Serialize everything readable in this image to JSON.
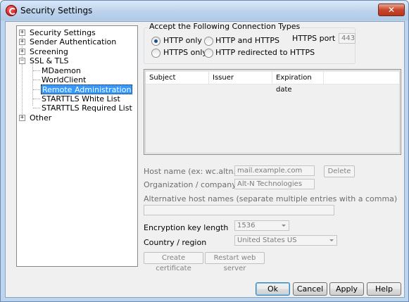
{
  "window": {
    "title": "Security Settings",
    "close_label": "✕"
  },
  "tree": {
    "items": [
      {
        "label": "Security Settings",
        "expander": "+"
      },
      {
        "label": "Sender Authentication",
        "expander": "+"
      },
      {
        "label": "Screening",
        "expander": "+"
      },
      {
        "label": "SSL & TLS",
        "expander": "−"
      },
      {
        "label": "MDaemon"
      },
      {
        "label": "WorldClient"
      },
      {
        "label": "Remote Administration",
        "selected": true
      },
      {
        "label": "STARTTLS White List"
      },
      {
        "label": "STARTTLS Required List"
      },
      {
        "label": "Other",
        "expander": "+"
      }
    ]
  },
  "connection": {
    "group_title": "Accept the Following Connection Types",
    "options": [
      {
        "label": "HTTP only",
        "checked": true
      },
      {
        "label": "HTTP and HTTPS",
        "checked": false
      },
      {
        "label": "HTTPS only",
        "checked": false
      },
      {
        "label": "HTTP redirected to HTTPS",
        "checked": false
      }
    ],
    "https_port_label": "HTTPS port",
    "https_port_value": "443"
  },
  "cert_list": {
    "columns": [
      "Subject",
      "Issuer",
      "Expiration date"
    ]
  },
  "form": {
    "host_label": "Host name (ex: wc.altn.com)",
    "host_value": "mail.example.com",
    "delete_label": "Delete",
    "org_label": "Organization / company name",
    "org_value": "Alt-N Technologies",
    "alt_hosts_label": "Alternative host names (separate multiple entries with a comma)",
    "alt_hosts_value": "",
    "key_length_label": "Encryption key length",
    "key_length_value": "1536",
    "country_label": "Country / region",
    "country_value": "United States US",
    "create_cert_label": "Create certificate",
    "restart_label": "Restart web server"
  },
  "footer": {
    "ok": "Ok",
    "cancel": "Cancel",
    "apply": "Apply",
    "help": "Help"
  },
  "colors": {
    "selection": "#3399ff",
    "window_frame": "#bcd4ec",
    "close_button": "#c7462b"
  }
}
